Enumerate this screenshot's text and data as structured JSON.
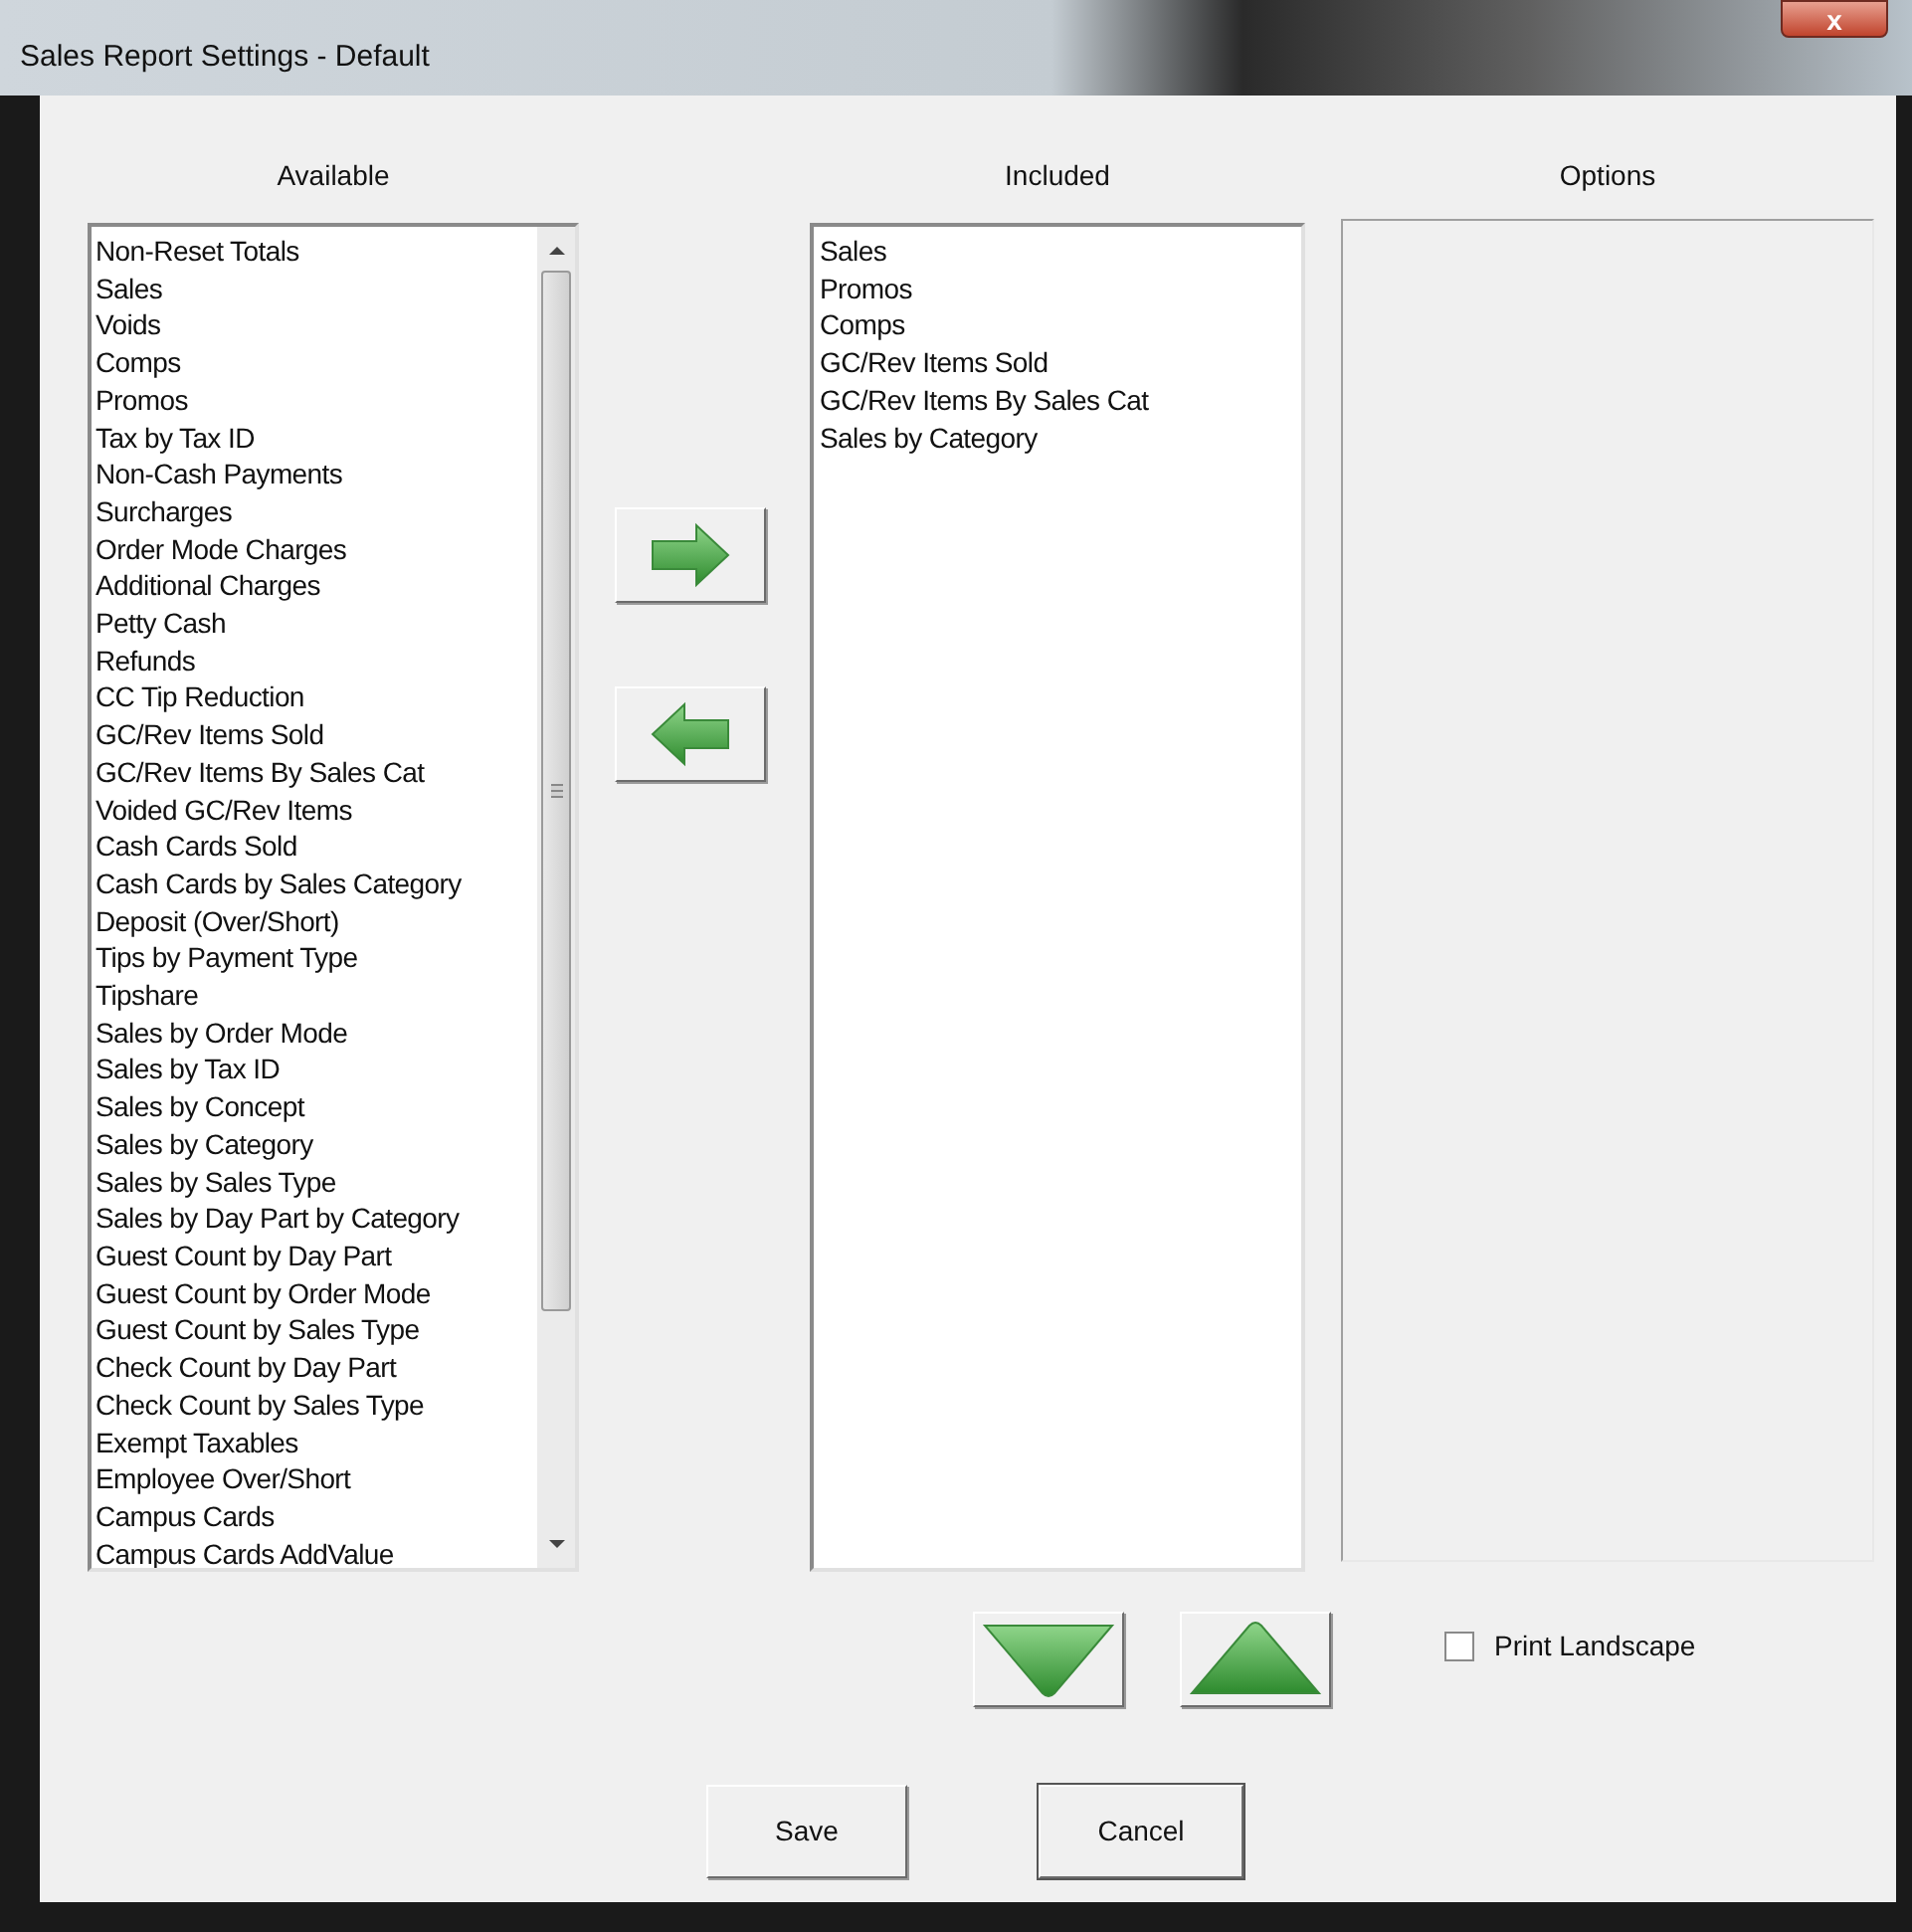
{
  "window": {
    "title": "Sales Report Settings - Default",
    "close": "x"
  },
  "available": {
    "heading": "Available",
    "items": [
      "Non-Reset Totals",
      "Sales",
      "Voids",
      "Comps",
      "Promos",
      "Tax by Tax ID",
      "Non-Cash Payments",
      "Surcharges",
      "Order Mode Charges",
      "Additional Charges",
      "Petty Cash",
      "Refunds",
      "CC Tip Reduction",
      "GC/Rev Items Sold",
      "GC/Rev Items By Sales Cat",
      "Voided GC/Rev Items",
      "Cash Cards Sold",
      "Cash Cards by Sales Category",
      "Deposit (Over/Short)",
      "Tips by Payment Type",
      "Tipshare",
      "Sales by Order Mode",
      "Sales by Tax ID",
      "Sales by Concept",
      "Sales by Category",
      "Sales by Sales Type",
      "Sales by Day Part by Category",
      "Guest Count by Day Part",
      "Guest Count by Order Mode",
      "Guest Count by Sales Type",
      "Check Count by Day Part",
      "Check Count by Sales Type",
      "Exempt Taxables",
      "Employee Over/Short",
      "Campus Cards",
      "Campus Cards AddValue"
    ]
  },
  "included": {
    "heading": "Included",
    "items": [
      "Sales",
      "Promos",
      "Comps",
      "GC/Rev Items Sold",
      "GC/Rev Items By Sales Cat",
      "Sales by Category"
    ]
  },
  "options": {
    "heading": "Options",
    "print_landscape": {
      "label": "Print Landscape",
      "checked": false
    }
  },
  "buttons": [
    "Save",
    "Cancel"
  ]
}
